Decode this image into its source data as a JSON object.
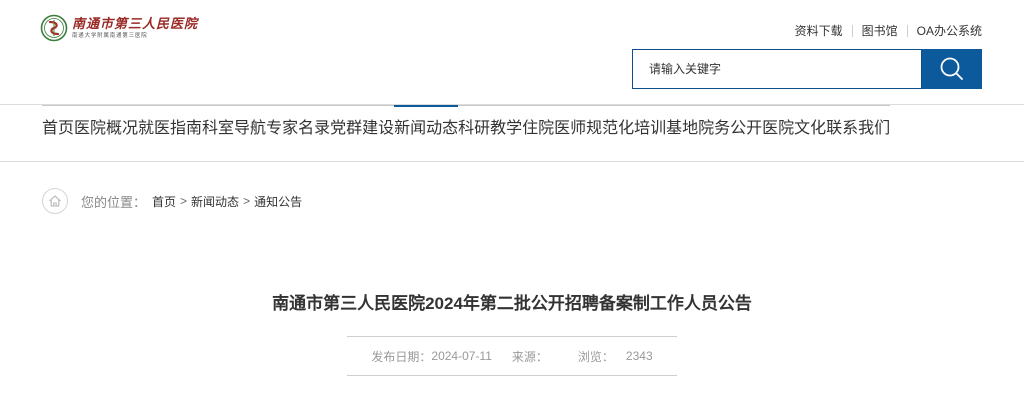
{
  "header": {
    "logo": {
      "name_cn": "南通市第三人民医院",
      "subtitle": "南通大学附属南通第三医院"
    },
    "top_links": [
      "资料下载",
      "图书馆",
      "OA办公系统"
    ],
    "search": {
      "placeholder": "请输入关键字",
      "icon": "search-icon"
    }
  },
  "nav": {
    "items": [
      "首页",
      "医院概况",
      "就医指南",
      "科室导航",
      "专家名录",
      "党群建设",
      "新闻动态",
      "科研教学",
      "住院医师规范化培训基地",
      "院务公开",
      "医院文化",
      "联系我们"
    ],
    "active": "新闻动态"
  },
  "breadcrumb": {
    "label": "您的位置：",
    "items": [
      "首页",
      "新闻动态",
      "通知公告"
    ],
    "separator": ">"
  },
  "article": {
    "title": "南通市第三人民医院2024年第二批公开招聘备案制工作人员公告",
    "publish_label": "发布日期：",
    "publish_date": "2024-07-11",
    "source_label": "来源：",
    "source": "",
    "views_label": "浏览：",
    "views": "2343"
  },
  "colors": {
    "brand_blue": "#0c5a9c",
    "logo_red": "#9a2a26"
  }
}
